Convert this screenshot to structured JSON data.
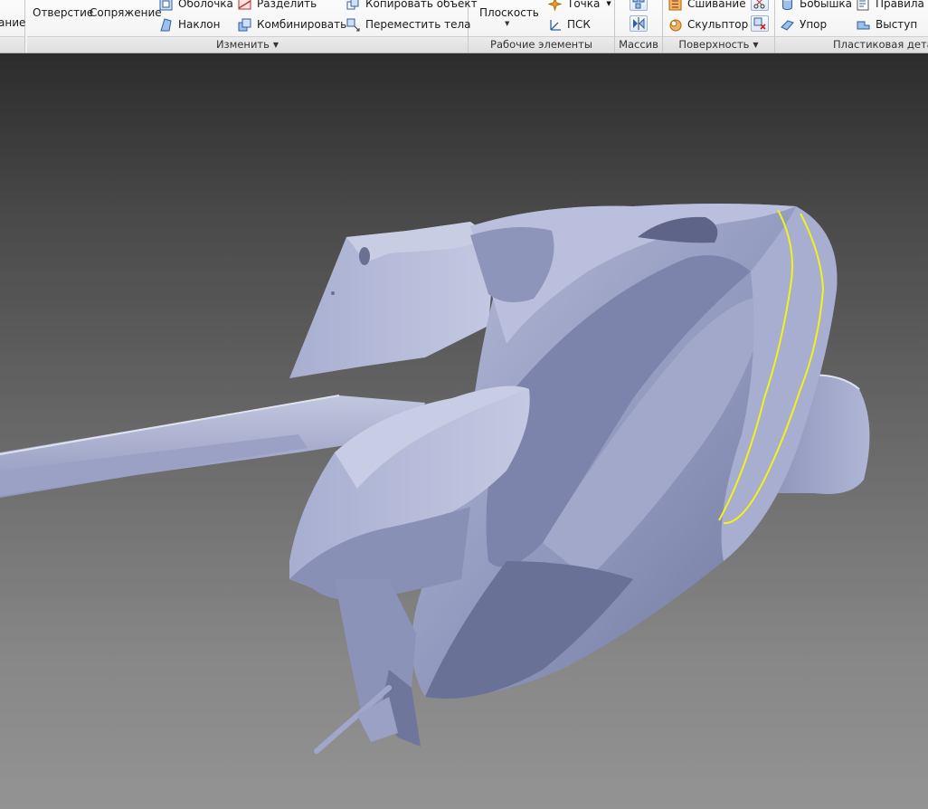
{
  "ribbon": {
    "cut_left_label": "ание",
    "hole_label": "Отверстие",
    "fillet_label": "Сопряжение",
    "shell_label": "Оболочка",
    "draft_label": "Наклон",
    "split_label": "Разделить",
    "combine_label": "Комбинировать",
    "copy_object_label": "Копировать объект",
    "move_bodies_label": "Переместить тела",
    "modify_panel_title": "Изменить",
    "plane_label": "Плоскость",
    "point_label": "Точка",
    "ucs_label": "ПСК",
    "work_features_title": "Рабочие элементы",
    "pattern_title": "Массив",
    "stitch_label": "Сшивание",
    "sculpt_label": "Скульптор",
    "surface_title": "Поверхность",
    "boss_label": "Бобышка",
    "rule_label": "Правила с",
    "rest_label": "Упор",
    "lip_label": "Выступ",
    "plastic_part_title": "Пластиковая детал"
  },
  "colors": {
    "ribbon_bg": "#f1f1f1",
    "viewport_top": "#2c2c2c",
    "viewport_bottom": "#939393",
    "model_surface": "#9ea5c8",
    "selected_edge": "#f2f21a"
  },
  "icons": {
    "shell": "shell-icon",
    "draft": "draft-icon",
    "split": "split-icon",
    "combine": "combine-icon",
    "copy_object": "copy-object-icon",
    "move_bodies": "move-bodies-icon",
    "point": "point-icon",
    "ucs": "ucs-icon",
    "rectangular_pattern": "rectangular-pattern-icon",
    "mirror": "mirror-icon",
    "stitch": "stitch-icon",
    "sculpt": "sculpt-icon",
    "boss": "boss-icon",
    "rule_fillet": "rule-fillet-icon",
    "rest": "rest-icon",
    "lip": "lip-icon"
  }
}
